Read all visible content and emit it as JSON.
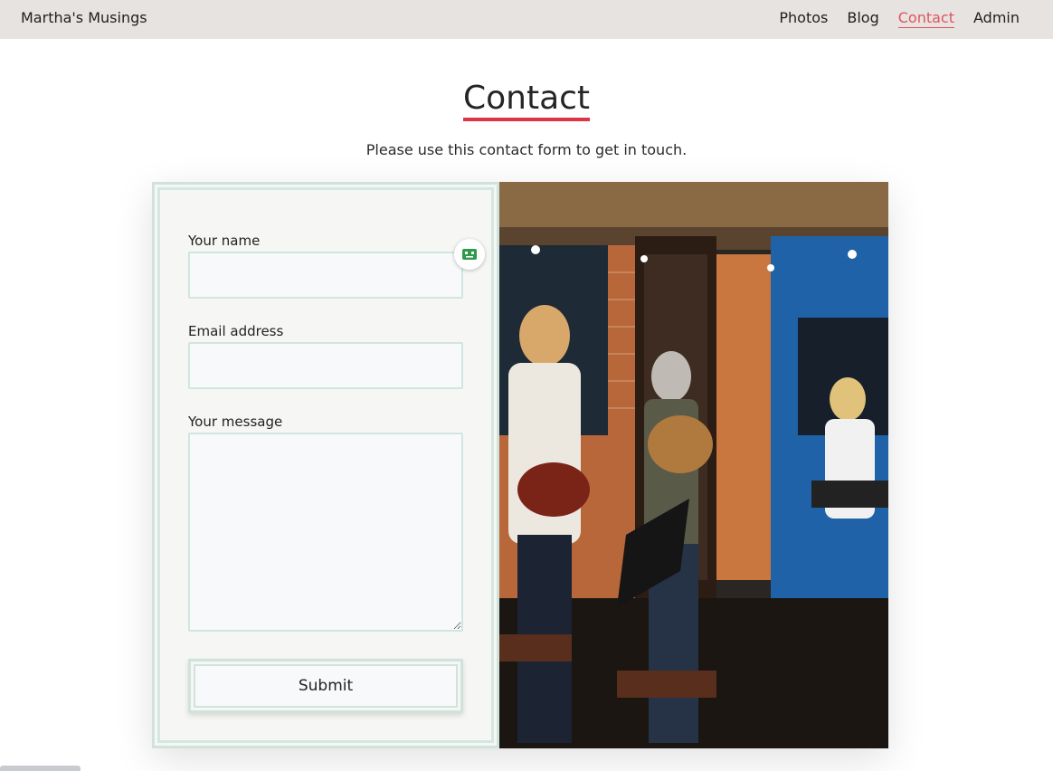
{
  "site": {
    "brand": "Martha's Musings"
  },
  "nav": {
    "items": [
      "Photos",
      "Blog",
      "Contact",
      "Admin"
    ],
    "active": "Contact"
  },
  "page": {
    "title": "Contact",
    "subtitle": "Please use this contact form to get in touch."
  },
  "form": {
    "name_label": "Your name",
    "name_value": "",
    "email_label": "Email address",
    "email_value": "",
    "message_label": "Your message",
    "message_value": "",
    "submit_label": "Submit"
  },
  "icons": {
    "autofill": "robot-icon"
  },
  "colors": {
    "accent": "#dc3545",
    "navbar": "#e7e3e1",
    "panel_border": "#cfe3dc",
    "robot": "#2e9a4a"
  }
}
